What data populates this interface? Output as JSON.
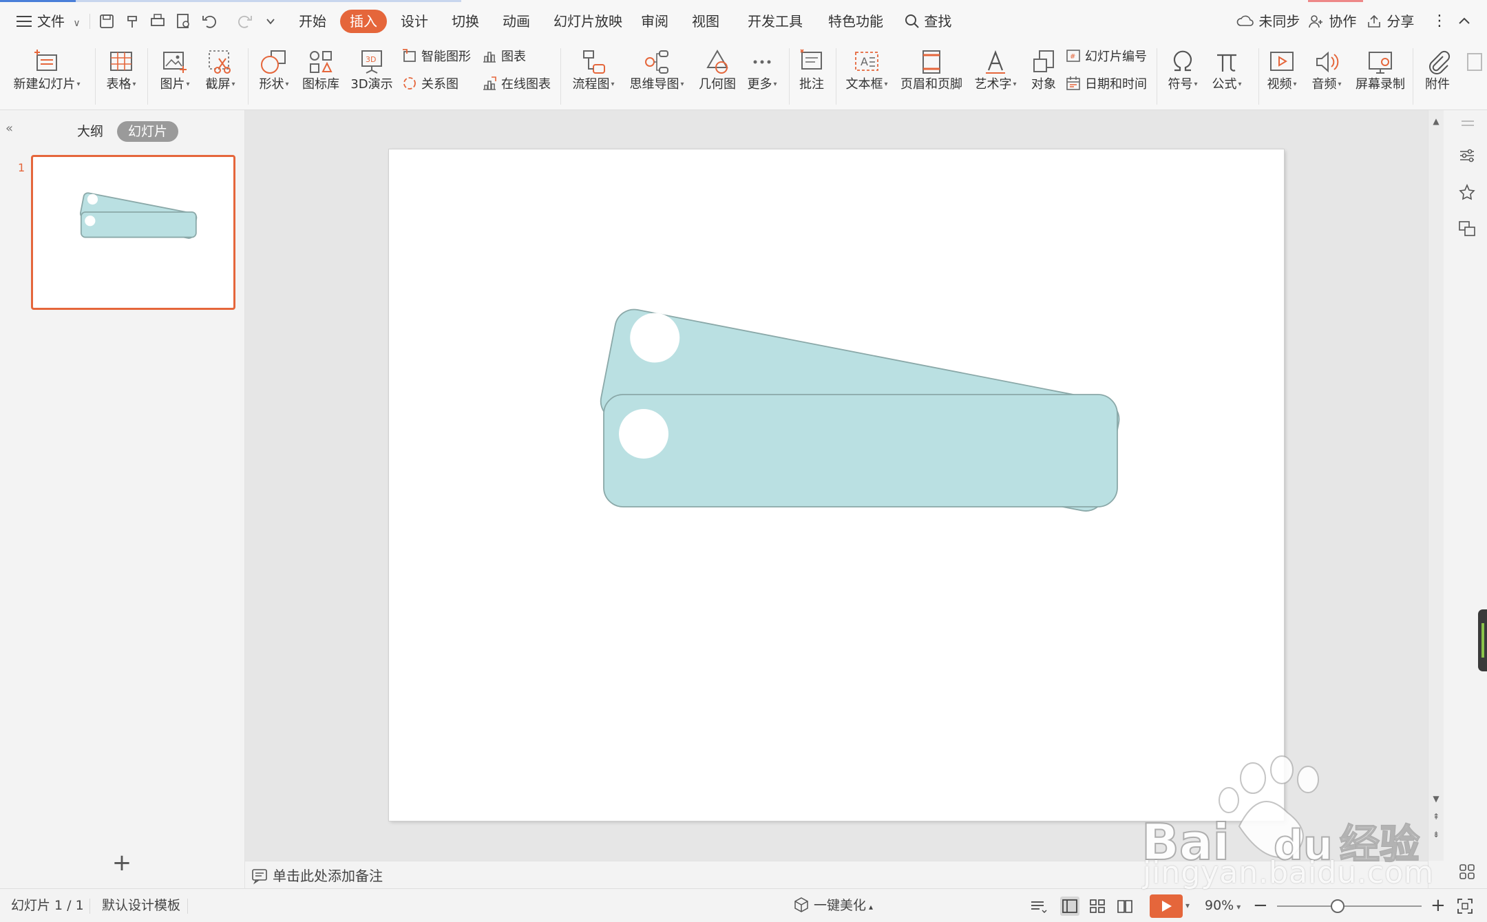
{
  "menubar": {
    "file_label": "文件",
    "tabs": [
      "开始",
      "插入",
      "设计",
      "切换",
      "动画",
      "幻灯片放映",
      "审阅",
      "视图",
      "开发工具",
      "特色功能"
    ],
    "active_tab": "插入",
    "search_label": "查找",
    "sync_label": "未同步",
    "collab_label": "协作",
    "share_label": "分享"
  },
  "ribbon": {
    "new_slide": "新建幻灯片",
    "table": "表格",
    "picture": "图片",
    "screenshot": "截屏",
    "shape": "形状",
    "icon_lib": "图标库",
    "demo3d": "3D演示",
    "smart_shape": "智能图形",
    "chart": "图表",
    "relation": "关系图",
    "online_chart": "在线图表",
    "flowchart": "流程图",
    "mindmap": "思维导图",
    "geometry": "几何图",
    "more": "更多",
    "comment": "批注",
    "textbox": "文本框",
    "header_footer": "页眉和页脚",
    "wordart": "艺术字",
    "object": "对象",
    "slide_number": "幻灯片编号",
    "date_time": "日期和时间",
    "symbol": "符号",
    "formula": "公式",
    "video": "视频",
    "audio": "音频",
    "screen_record": "屏幕录制",
    "attachment": "附件"
  },
  "leftpanel": {
    "tab_outline": "大纲",
    "tab_slides": "幻灯片",
    "thumb_number": "1"
  },
  "notes": {
    "placeholder": "单击此处添加备注"
  },
  "statusbar": {
    "slide_counter": "幻灯片 1 / 1",
    "template": "默认设计模板",
    "beautify": "一键美化",
    "zoom": "90%"
  },
  "watermark": {
    "brand": "Bai du 经验",
    "url": "jingyan.baidu.com"
  },
  "colors": {
    "accent": "#e5663b",
    "shape_fill": "#bae0e2",
    "shape_stroke": "#8aa8a8"
  }
}
